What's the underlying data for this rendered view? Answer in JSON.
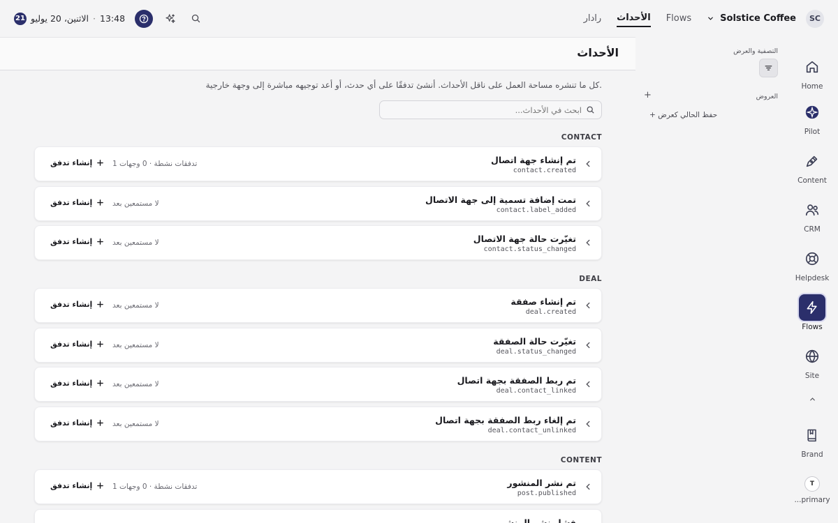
{
  "topbar": {
    "notifications": "21",
    "date": "الاثنين، 20 يوليو",
    "time": "13:48",
    "separator": "·",
    "tabs": [
      {
        "label": "رادار"
      },
      {
        "label": "الأحداث",
        "active": true
      },
      {
        "label": "Flows"
      }
    ],
    "workspace_name": "Solstice Coffee",
    "avatar_initials": "SC"
  },
  "sidebar": {
    "items": [
      {
        "label": "Home",
        "icon": "home-icon"
      },
      {
        "label": "Pilot",
        "icon": "pilot-icon"
      },
      {
        "label": "Content",
        "icon": "pen-icon"
      },
      {
        "label": "CRM",
        "icon": "users-icon"
      },
      {
        "label": "Helpdesk",
        "icon": "lifebuoy-icon"
      },
      {
        "label": "Flows",
        "icon": "lightning-icon",
        "active": true
      },
      {
        "label": "Site",
        "icon": "globe-icon"
      },
      {
        "label": "Brand",
        "icon": "book-icon"
      },
      {
        "label": "..._primary",
        "icon": "avatar"
      }
    ],
    "tenant_initial": "T",
    "tenant_label": "...primary",
    "brand_label": "Brand"
  },
  "filters": {
    "title": "التصفية والعرض",
    "views_label": "العروض",
    "add_view": "+",
    "save_view": "+ حفظ الحالي كعرض"
  },
  "main": {
    "title": "الأحداث",
    "description": "كل ما تنشره مساحة العمل على ناقل الأحداث. أنشئ تدفقًا على أي حدث، أو أعد توجيهه مباشرة إلى وجهة خارجية.",
    "search_placeholder": "ابحث في الأحداث..."
  },
  "groups": [
    {
      "label": "CONTACT",
      "events": [
        {
          "title": "تم إنشاء جهة اتصال",
          "key": "contact.created",
          "meta": "1 تدفقات نشطة · 0 وجهات",
          "action": "إنشاء تدفق"
        },
        {
          "title": "تمت إضافة تسمية إلى جهة الاتصال",
          "key": "contact.label_added",
          "meta": "لا مستمعين بعد",
          "action": "إنشاء تدفق"
        },
        {
          "title": "تغيّرت حالة جهة الاتصال",
          "key": "contact.status_changed",
          "meta": "لا مستمعين بعد",
          "action": "إنشاء تدفق"
        }
      ]
    },
    {
      "label": "DEAL",
      "events": [
        {
          "title": "تم إنشاء صفقة",
          "key": "deal.created",
          "meta": "لا مستمعين بعد",
          "action": "إنشاء تدفق"
        },
        {
          "title": "تغيّرت حالة الصفقة",
          "key": "deal.status_changed",
          "meta": "لا مستمعين بعد",
          "action": "إنشاء تدفق"
        },
        {
          "title": "تم ربط الصفقة بجهة اتصال",
          "key": "deal.contact_linked",
          "meta": "لا مستمعين بعد",
          "action": "إنشاء تدفق"
        },
        {
          "title": "تم إلغاء ربط الصفقة بجهة اتصال",
          "key": "deal.contact_unlinked",
          "meta": "لا مستمعين بعد",
          "action": "إنشاء تدفق"
        }
      ]
    },
    {
      "label": "CONTENT",
      "events": [
        {
          "title": "تم نشر المنشور",
          "key": "post.published",
          "meta": "1 تدفقات نشطة · 0 وجهات",
          "action": "إنشاء تدفق"
        },
        {
          "title": "فشل نشر المنشور",
          "key": "",
          "meta": "",
          "action": ""
        }
      ]
    }
  ]
}
